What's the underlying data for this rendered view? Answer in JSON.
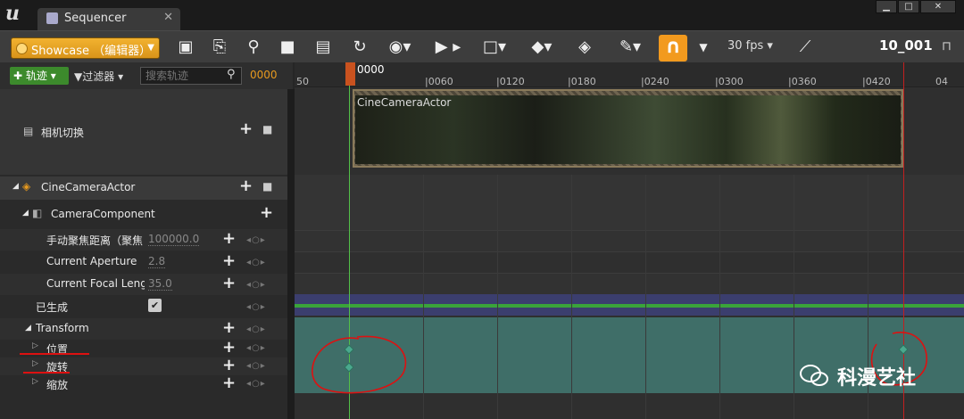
{
  "window": {
    "tab_title": "Sequencer",
    "tab_close": "✕",
    "btn_min": "▁",
    "btn_max": "□",
    "btn_close": "✕"
  },
  "toolbar": {
    "sequence_name": "Showcase （编辑器）",
    "fps": "30 fps",
    "end_frame": "10_001",
    "accent": "#f29a1e"
  },
  "tracks_bar": {
    "add_track": "轨迹",
    "filter": "过滤器",
    "search_placeholder": "搜索轨迹",
    "current_frame": "0000"
  },
  "ruler": {
    "playhead_frame": "0000",
    "ticks": [
      "|0060",
      "|0120",
      "|0180",
      "|0240",
      "|0300",
      "|0360",
      "|0420"
    ],
    "left_edge": "50",
    "right_edge": "04"
  },
  "outliner": {
    "camera_cut": "相机切换",
    "actor": "CineCameraActor",
    "component": "CameraComponent",
    "props": [
      {
        "label": "手动聚焦距离（聚焦",
        "value": "100000.0"
      },
      {
        "label": "Current Aperture",
        "value": "2.8"
      },
      {
        "label": "Current Focal Leng",
        "value": "35.0"
      }
    ],
    "spawned": "已生成",
    "transform": "Transform",
    "transform_children": [
      "位置",
      "旋转",
      "缩放"
    ]
  },
  "section": {
    "camera_section_label": "CineCameraActor"
  },
  "watermark": "科漫艺社"
}
